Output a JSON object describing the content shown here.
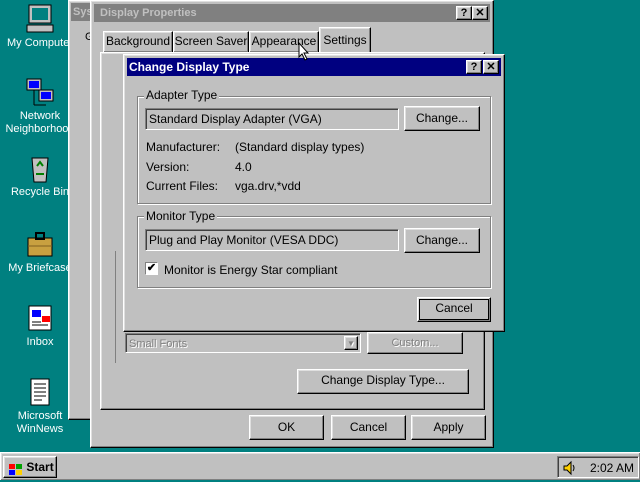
{
  "desktop": {
    "icons": [
      {
        "label": "My Computer"
      },
      {
        "label": "Network Neighborhood"
      },
      {
        "label": "Recycle Bin"
      },
      {
        "label": "My Briefcase"
      },
      {
        "label": "Inbox"
      },
      {
        "label": "Microsoft WinNews"
      }
    ]
  },
  "display_properties": {
    "title_prefix": "Sys",
    "title": "Display Properties",
    "tabs": [
      "Background",
      "Screen Saver",
      "Appearance",
      "Settings"
    ],
    "font_size_value": "Small Fonts",
    "custom_button": "Custom...",
    "change_display_type_button": "Change Display Type...",
    "ok_button": "OK",
    "cancel_button": "Cancel",
    "apply_button": "Apply",
    "help_glyph": "?",
    "close_glyph": "✕"
  },
  "change_display_type": {
    "title": "Change Display Type",
    "help_glyph": "?",
    "close_glyph": "✕",
    "adapter_group_label": "Adapter Type",
    "adapter_value": "Standard Display Adapter (VGA)",
    "adapter_change_button": "Change...",
    "manufacturer_label": "Manufacturer:",
    "manufacturer_value": "(Standard display types)",
    "version_label": "Version:",
    "version_value": "4.0",
    "files_label": "Current Files:",
    "files_value": "vga.drv,*vdd",
    "monitor_group_label": "Monitor Type",
    "monitor_value": "Plug and Play Monitor (VESA DDC)",
    "monitor_change_button": "Change...",
    "energy_star_label": "Monitor is Energy Star compliant",
    "energy_star_checked": true,
    "cancel_button": "Cancel"
  },
  "taskbar": {
    "start_label": "Start",
    "clock": "2:02 AM"
  }
}
